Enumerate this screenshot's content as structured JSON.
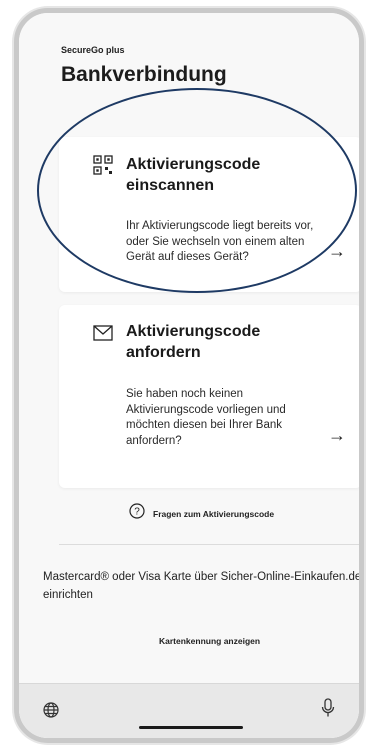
{
  "header": {
    "app_name": "SecureGo plus",
    "title": "Bankverbindung"
  },
  "cards": [
    {
      "icon": "qr-code-icon",
      "title": "Aktivierungscode einscannen",
      "description": "Ihr Aktivierungscode liegt bereits vor, oder Sie wechseln von einem alten Gerät auf dieses Gerät?",
      "arrow": "→"
    },
    {
      "icon": "envelope-icon",
      "title": "Aktivierungscode anfordern",
      "description": "Sie haben noch keinen Aktivierungscode vorliegen und möchten diesen bei Ihrer Bank anfordern?",
      "arrow": "→"
    }
  ],
  "faq": {
    "icon": "question-circle-icon",
    "label": "Fragen zum Aktivierungscode"
  },
  "mastercard": {
    "text": "Mastercard® oder Visa Karte über Sicher-Online-Einkaufen.de einrichten",
    "link_label": "Kartenkennung anzeigen"
  },
  "colors": {
    "highlight": "#1e3a64",
    "card_bg": "#ffffff",
    "screen_bg": "#f8f8f8"
  },
  "bottom_bar": {
    "left_icon": "globe-icon",
    "right_icon": "microphone-icon"
  }
}
